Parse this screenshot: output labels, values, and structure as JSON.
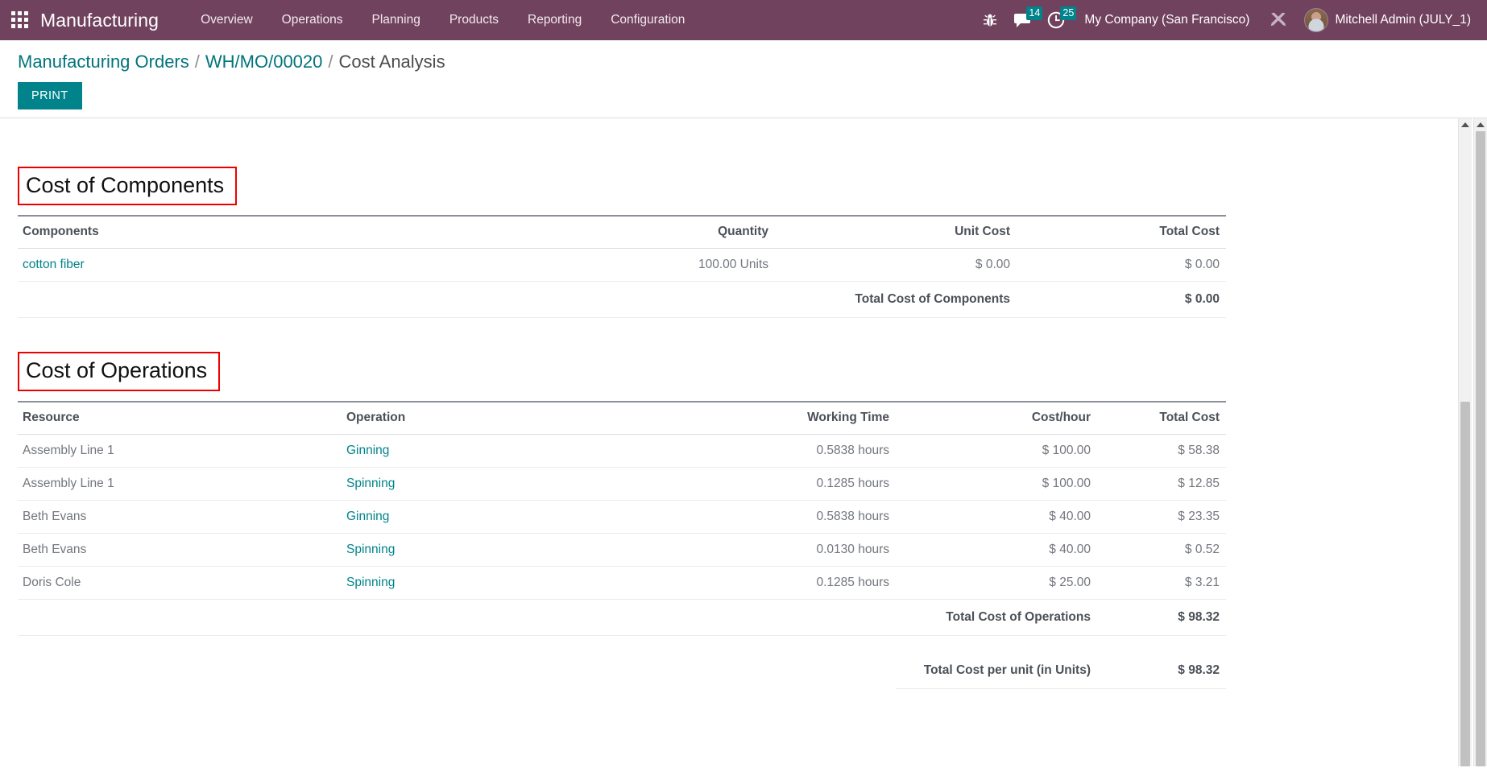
{
  "navbar": {
    "apps_icon": "apps-grid-icon",
    "brand": "Manufacturing",
    "menu": [
      {
        "label": "Overview"
      },
      {
        "label": "Operations"
      },
      {
        "label": "Planning"
      },
      {
        "label": "Products"
      },
      {
        "label": "Reporting"
      },
      {
        "label": "Configuration"
      }
    ],
    "bug_icon": "bug-icon",
    "messages_icon": "chat-bubble-icon",
    "messages_count": "14",
    "activities_icon": "clock-icon",
    "activities_count": "25",
    "company": "My Company (San Francisco)",
    "tools_icon": "wrench-tools-icon",
    "avatar": "user-avatar",
    "user": "Mitchell Admin (JULY_1)",
    "accent_color": "#71425e",
    "badge_color": "#00838a"
  },
  "breadcrumb": {
    "root": "Manufacturing Orders",
    "sep1": "/",
    "record": "WH/MO/00020",
    "sep2": "/",
    "current": "Cost Analysis"
  },
  "toolbar": {
    "print_label": "PRINT",
    "print_color": "#00838a"
  },
  "components_section": {
    "title": "Cost of Components",
    "highlight_color": "#ee0000",
    "headers": {
      "name": "Components",
      "quantity": "Quantity",
      "unit_cost": "Unit Cost",
      "total_cost": "Total Cost"
    },
    "rows": [
      {
        "name": "cotton fiber",
        "quantity": "100.00 Units",
        "unit_cost": "$ 0.00",
        "total_cost": "$ 0.00"
      }
    ],
    "total": {
      "label": "Total Cost of Components",
      "value": "$ 0.00"
    }
  },
  "operations_section": {
    "title": "Cost of Operations",
    "highlight_color": "#ee0000",
    "headers": {
      "resource": "Resource",
      "operation": "Operation",
      "working_time": "Working Time",
      "cost_hour": "Cost/hour",
      "total_cost": "Total Cost"
    },
    "rows": [
      {
        "resource": "Assembly Line 1",
        "operation": "Ginning",
        "working_time": "0.5838 hours",
        "cost_hour": "$ 100.00",
        "total_cost": "$ 58.38"
      },
      {
        "resource": "Assembly Line 1",
        "operation": "Spinning",
        "working_time": "0.1285 hours",
        "cost_hour": "$ 100.00",
        "total_cost": "$ 12.85"
      },
      {
        "resource": "Beth Evans",
        "operation": "Ginning",
        "working_time": "0.5838 hours",
        "cost_hour": "$ 40.00",
        "total_cost": "$ 23.35"
      },
      {
        "resource": "Beth Evans",
        "operation": "Spinning",
        "working_time": "0.0130 hours",
        "cost_hour": "$ 40.00",
        "total_cost": "$ 0.52"
      },
      {
        "resource": "Doris Cole",
        "operation": "Spinning",
        "working_time": "0.1285 hours",
        "cost_hour": "$ 25.00",
        "total_cost": "$ 3.21"
      }
    ],
    "total": {
      "label": "Total Cost of Operations",
      "value": "$ 98.32"
    },
    "per_unit": {
      "label": "Total Cost per unit (in Units)",
      "value": "$ 98.32"
    }
  }
}
